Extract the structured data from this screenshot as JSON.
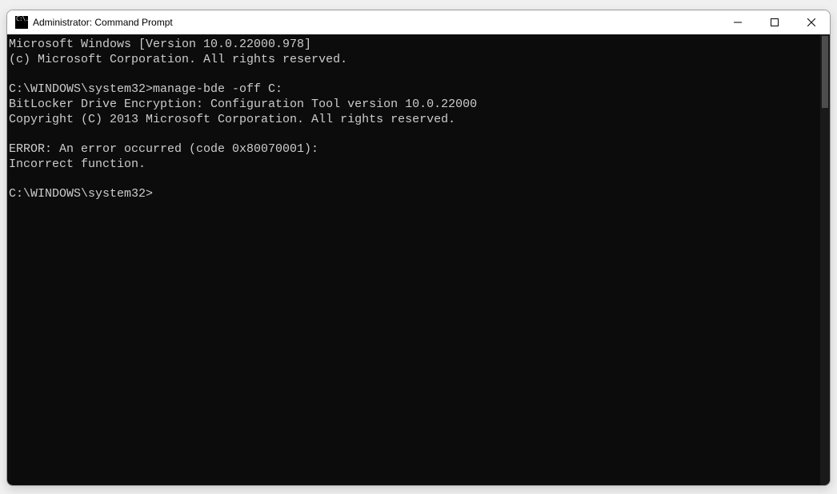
{
  "window": {
    "title": "Administrator: Command Prompt",
    "icon_glyph": "C:\\."
  },
  "terminal": {
    "line_version": "Microsoft Windows [Version 10.0.22000.978]",
    "line_copyright": "(c) Microsoft Corporation. All rights reserved.",
    "blank1": "",
    "prompt1_path": "C:\\WINDOWS\\system32>",
    "prompt1_cmd": "manage-bde -off C:",
    "line_tool": "BitLocker Drive Encryption: Configuration Tool version 10.0.22000",
    "line_tool_copyright": "Copyright (C) 2013 Microsoft Corporation. All rights reserved.",
    "blank2": "",
    "line_error": "ERROR: An error occurred (code 0x80070001):",
    "line_error_msg": "Incorrect function.",
    "blank3": "",
    "prompt2_path": "C:\\WINDOWS\\system32>"
  }
}
